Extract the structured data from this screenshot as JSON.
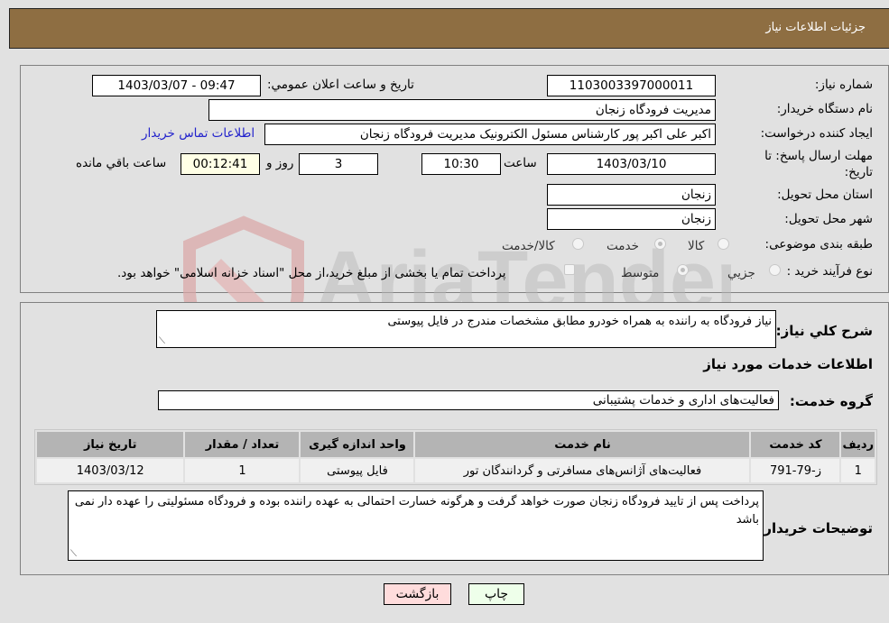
{
  "header": {
    "title": "جزئیات اطلاعات نیاز"
  },
  "details": {
    "need_number_label": "شماره نیاز:",
    "need_number": "1103003397000011",
    "announce_label": "تاریخ و ساعت اعلان عمومي:",
    "announce_value": "1403/03/07 - 09:47",
    "buyer_org_label": "نام دستگاه خریدار:",
    "buyer_org": "مدیریت فرودگاه زنجان",
    "creator_label": "ایجاد کننده درخواست:",
    "creator": "اکبر علی اکبر پور کارشناس مسئول الکترونیک مدیریت فرودگاه زنجان",
    "contact_link": "اطلاعات تماس خریدار",
    "deadline_label_line1": "مهلت ارسال پاسخ: تا",
    "deadline_label_line2": "تاریخ:",
    "deadline_date": "1403/03/10",
    "time_label": "ساعت",
    "deadline_time": "10:30",
    "days_value": "3",
    "days_label": "روز و",
    "remaining_time": "00:12:41",
    "remaining_label": "ساعت باقي مانده",
    "province_label": "استان محل تحویل:",
    "province": "زنجان",
    "city_label": "شهر محل تحویل:",
    "city": "زنجان",
    "category_label": "طبقه بندی موضوعی:",
    "category_options": [
      "کالا",
      "خدمت",
      "کالا/خدمت"
    ],
    "category_selected": "خدمت",
    "purchase_type_label": "نوع فرآیند خرید :",
    "purchase_options": [
      "جزيي",
      "متوسط"
    ],
    "purchase_selected": "متوسط",
    "treasury_note": "پرداخت تمام یا بخشی از مبلغ خرید،از محل \"اسناد خزانه اسلامی\" خواهد بود."
  },
  "summary": {
    "description_label": "شرح كلي نياز:",
    "description": "نیاز فرودگاه به راننده به همراه خودرو مطابق مشخصات مندرج در فایل پیوستی",
    "services_heading": "اطلاعات خدمات مورد نیاز",
    "service_group_label": "گروه خدمت:",
    "service_group": "فعالیت‌های اداری و خدمات پشتیبانی"
  },
  "table": {
    "headers": [
      "ردیف",
      "کد خدمت",
      "نام خدمت",
      "واحد اندازه گیری",
      "تعداد / مقدار",
      "تاریخ نیاز"
    ],
    "rows": [
      [
        "1",
        "ز-79-791",
        "فعالیت‌های آژانس‌های مسافرتی و گردانندگان تور",
        "فایل پیوستی",
        "1",
        "1403/03/12"
      ]
    ]
  },
  "buyer_notes": {
    "label": "توضیحات خریدار:",
    "text": "پرداخت پس از تایید فرودگاه زنجان صورت خواهد گرفت و هرگونه خسارت احتمالی به عهده راننده بوده و فرودگاه مسئولیتی را عهده دار نمی باشد"
  },
  "buttons": {
    "print": "چاپ",
    "back": "بازگشت"
  },
  "watermark": {
    "text": "AriaTender.neT"
  }
}
